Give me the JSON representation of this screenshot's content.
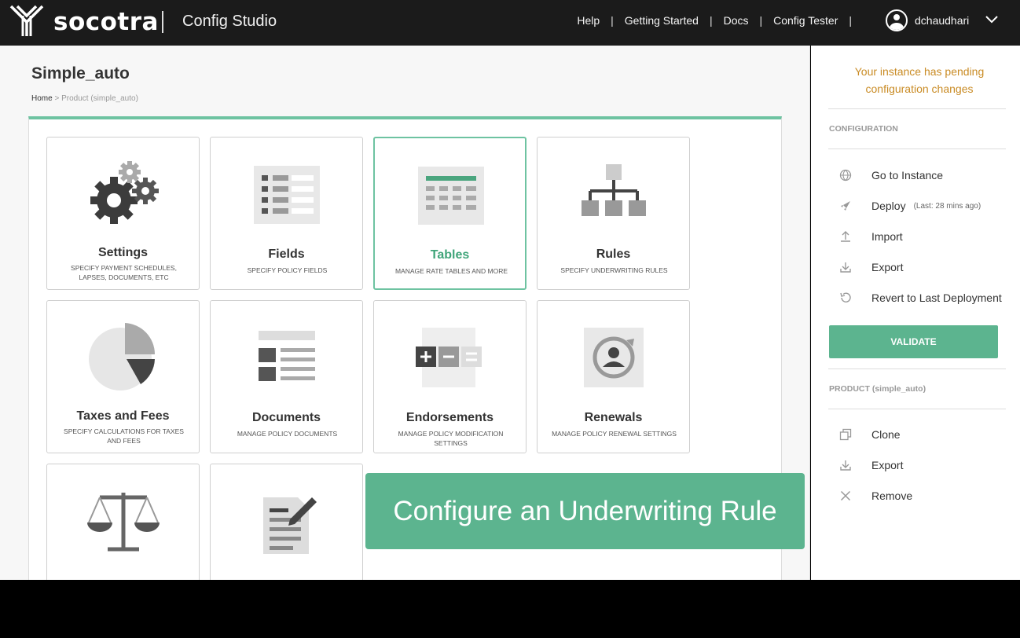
{
  "header": {
    "brand": "socotra",
    "app_name": "Config Studio",
    "nav": [
      "Help",
      "Getting Started",
      "Docs",
      "Config Tester"
    ],
    "username": "dchaudhari"
  },
  "page": {
    "title": "Simple_auto",
    "breadcrumb_home": "Home",
    "breadcrumb_rest": " > Product (simple_auto)"
  },
  "cards": [
    {
      "title": "Settings",
      "desc": "Specify payment schedules, lapses, documents, etc"
    },
    {
      "title": "Fields",
      "desc": "Specify policy fields"
    },
    {
      "title": "Tables",
      "desc": "Manage rate tables and more"
    },
    {
      "title": "Rules",
      "desc": "Specify underwriting rules"
    },
    {
      "title": "Taxes and Fees",
      "desc": "Specify calculations for taxes and fees"
    },
    {
      "title": "Documents",
      "desc": "Manage policy documents"
    },
    {
      "title": "Endorsements",
      "desc": "Manage policy modification settings"
    },
    {
      "title": "Renewals",
      "desc": "Manage policy renewal settings"
    }
  ],
  "banner": "Configure an Underwriting Rule",
  "sidebar": {
    "pending": "Your instance has pending configuration changes",
    "config_label": "CONFIGURATION",
    "config_items": [
      {
        "label": "Go to Instance",
        "icon": "globe-icon"
      },
      {
        "label": "Deploy",
        "note": "(Last: 28 mins ago)",
        "icon": "rocket-icon"
      },
      {
        "label": "Import",
        "icon": "upload-icon"
      },
      {
        "label": "Export",
        "icon": "download-icon"
      },
      {
        "label": "Revert to Last Deployment",
        "icon": "revert-icon"
      }
    ],
    "validate": "VALIDATE",
    "product_label": "PRODUCT (simple_auto)",
    "product_items": [
      {
        "label": "Clone",
        "icon": "clone-icon"
      },
      {
        "label": "Export",
        "icon": "download-icon"
      },
      {
        "label": "Remove",
        "icon": "close-icon"
      }
    ]
  },
  "colors": {
    "accent": "#5cb48f",
    "topbar": "#1b1b1b",
    "pending": "#c98b24"
  }
}
